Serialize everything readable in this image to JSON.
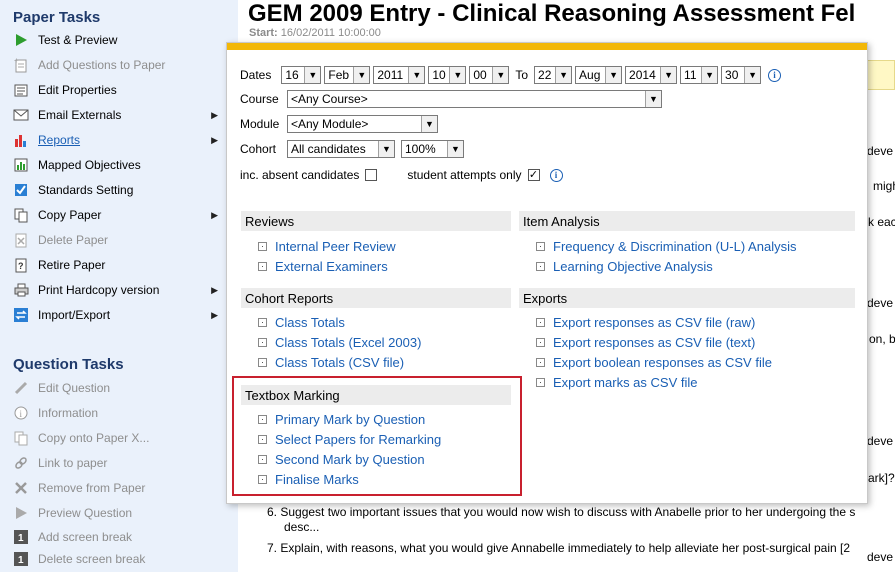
{
  "sidebar": {
    "paper_tasks_heading": "Paper Tasks",
    "paper_tasks": [
      {
        "label": "Test & Preview",
        "icon": "play-icon",
        "disabled": false,
        "arrow": false
      },
      {
        "label": "Add Questions to Paper",
        "icon": "add-questions-icon",
        "disabled": true,
        "arrow": false
      },
      {
        "label": "Edit Properties",
        "icon": "edit-properties-icon",
        "disabled": false,
        "arrow": false
      },
      {
        "label": "Email Externals",
        "icon": "envelope-icon",
        "disabled": false,
        "arrow": true
      },
      {
        "label": "Reports",
        "icon": "bar-chart-icon",
        "disabled": false,
        "arrow": true,
        "link": true
      },
      {
        "label": "Mapped Objectives",
        "icon": "mapped-objectives-icon",
        "disabled": false,
        "arrow": false
      },
      {
        "label": "Standards Setting",
        "icon": "checkbox-icon",
        "disabled": false,
        "arrow": false
      },
      {
        "label": "Copy Paper",
        "icon": "copy-icon",
        "disabled": false,
        "arrow": true
      },
      {
        "label": "Delete Paper",
        "icon": "delete-icon",
        "disabled": true,
        "arrow": false
      },
      {
        "label": "Retire Paper",
        "icon": "retire-icon",
        "disabled": false,
        "arrow": false
      },
      {
        "label": "Print Hardcopy version",
        "icon": "printer-icon",
        "disabled": false,
        "arrow": true
      },
      {
        "label": "Import/Export",
        "icon": "import-export-icon",
        "disabled": false,
        "arrow": true
      }
    ],
    "question_tasks_heading": "Question Tasks",
    "question_tasks": [
      {
        "label": "Edit Question",
        "icon": "pencil-icon"
      },
      {
        "label": "Information",
        "icon": "info-icon"
      },
      {
        "label": "Copy onto Paper X...",
        "icon": "copy-icon"
      },
      {
        "label": "Link to paper",
        "icon": "link-icon"
      },
      {
        "label": "Remove from Paper",
        "icon": "cross-icon"
      },
      {
        "label": "Preview Question",
        "icon": "play-icon"
      },
      {
        "label": "Add screen break",
        "icon": "screen-break-icon"
      },
      {
        "label": "Delete screen break",
        "icon": "screen-break-icon"
      }
    ]
  },
  "page": {
    "title": "GEM 2009 Entry - Clinical Reasoning Assessment Fel",
    "start_label": "Start:",
    "start_value": "16/02/2011 10:00:00",
    "fragments": [
      "deve",
      "migh",
      "k eac",
      "deve",
      "on, b",
      "deve",
      "ark]?",
      "deve"
    ],
    "q6_number": "6.",
    "q6_text": "Suggest two important issues that you would now wish to discuss with Anabelle prior to her undergoing the s",
    "q6_cont": "desc...",
    "q7_number": "7.",
    "q7_text": "Explain, with reasons, what you would give Annabelle immediately to help alleviate her post-surgical pain [2"
  },
  "popup": {
    "dates_label": "Dates",
    "from_day": "16",
    "from_month": "Feb",
    "from_year": "2011",
    "from_hour": "10",
    "from_min": "00",
    "to_label": "To",
    "to_day": "22",
    "to_month": "Aug",
    "to_year": "2014",
    "to_hour": "11",
    "to_min": "30",
    "course_label": "Course",
    "course_value": "<Any Course>",
    "module_label": "Module",
    "module_value": "<Any Module>",
    "cohort_label": "Cohort",
    "cohort_value": "All candidates",
    "percent_value": "100%",
    "absent_label": "inc. absent candidates",
    "student_only_label": "student attempts only",
    "reviews_heading": "Reviews",
    "reviews": [
      "Internal Peer Review",
      "External Examiners"
    ],
    "item_analysis_heading": "Item Analysis",
    "item_analysis": [
      "Frequency & Discrimination (U-L) Analysis",
      "Learning Objective Analysis"
    ],
    "cohort_reports_heading": "Cohort Reports",
    "cohort_reports": [
      "Class Totals",
      "Class Totals (Excel 2003)",
      "Class Totals (CSV file)"
    ],
    "exports_heading": "Exports",
    "exports": [
      "Export responses as CSV file (raw)",
      "Export responses as CSV file (text)",
      "Export boolean responses as CSV file",
      "Export marks as CSV file"
    ],
    "textbox_heading": "Textbox Marking",
    "textbox": [
      "Primary Mark by Question",
      "Select Papers for Remarking",
      "Second Mark by Question",
      "Finalise Marks"
    ]
  },
  "colors": {
    "accent_bar": "#f2b707",
    "link": "#1a5fb4",
    "highlight_box": "#c8202e",
    "sidebar_bg": "#eaf1fb"
  }
}
